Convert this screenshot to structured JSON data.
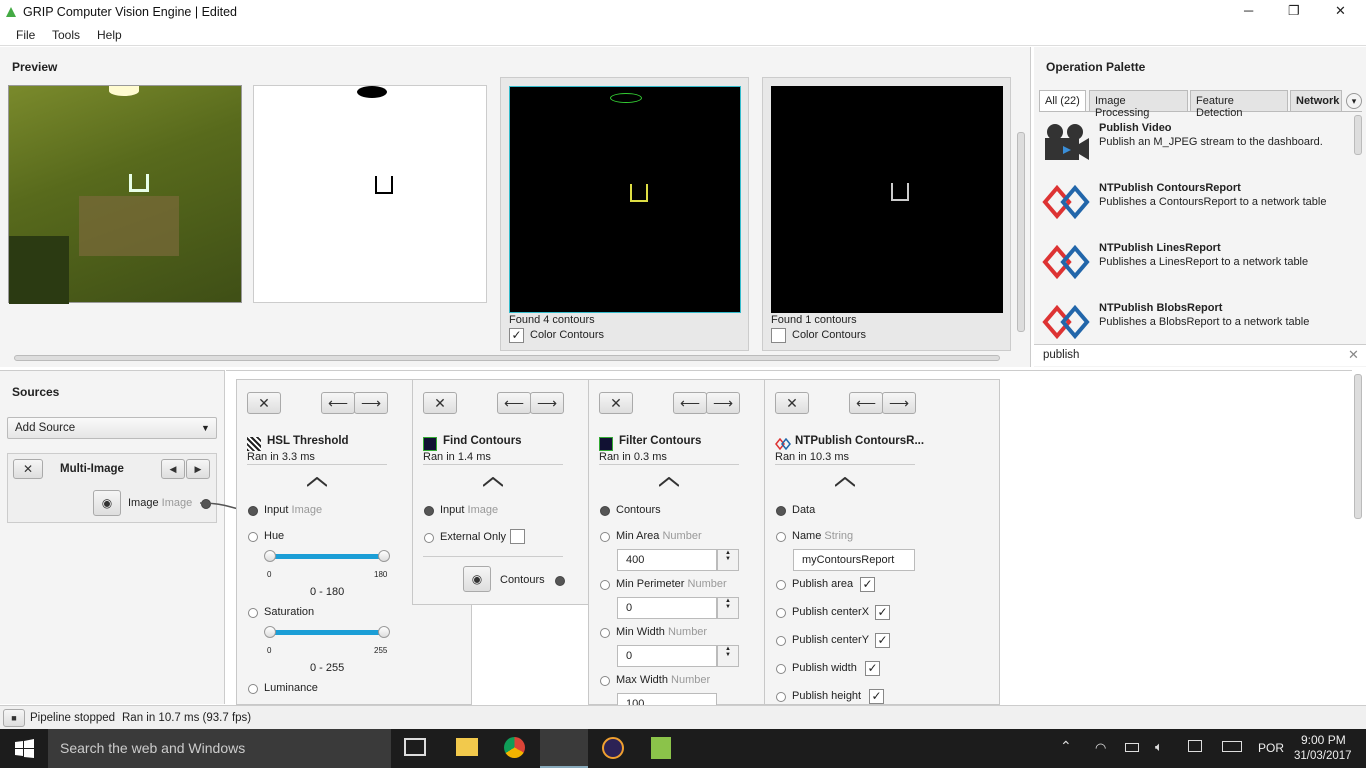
{
  "window": {
    "title": "GRIP Computer Vision Engine | Edited",
    "min": "─",
    "max": "❐",
    "close": "✕"
  },
  "menu": [
    "File",
    "Tools",
    "Help"
  ],
  "preview": {
    "title": "Preview",
    "contours1": "Found 4 contours",
    "contours2": "Found 1 contours",
    "color_contours": "Color Contours"
  },
  "palette": {
    "title": "Operation Palette",
    "tabs": [
      "All (22)",
      "Image Processing",
      "Feature Detection",
      "Network"
    ],
    "items": [
      {
        "name": "Publish Video",
        "desc": "Publish an M_JPEG stream to the dashboard."
      },
      {
        "name": "NTPublish ContoursReport",
        "desc": "Publishes a ContoursReport to a network table"
      },
      {
        "name": "NTPublish LinesReport",
        "desc": "Publishes a LinesReport to a network table"
      },
      {
        "name": "NTPublish BlobsReport",
        "desc": "Publishes a BlobsReport to a network table"
      }
    ],
    "search": "publish"
  },
  "sources": {
    "title": "Sources",
    "add": "Add Source",
    "card": "Multi-Image",
    "out": "Image",
    "out_type": "Image"
  },
  "steps": {
    "hsl": {
      "name": "HSL Threshold",
      "time": "Ran in 3.3 ms",
      "input": "Input",
      "input_type": "Image",
      "hue": "Hue",
      "hue_min": "0",
      "hue_max": "180",
      "hue_range": "0 - 180",
      "sat": "Saturation",
      "sat_min": "0",
      "sat_max": "255",
      "sat_range": "0 - 255",
      "lum": "Luminance"
    },
    "find": {
      "name": "Find Contours",
      "time": "Ran in 1.4 ms",
      "input": "Input",
      "input_type": "Image",
      "ext": "External Only",
      "out": "Contours"
    },
    "filter": {
      "name": "Filter Contours",
      "time": "Ran in 0.3 ms",
      "contours": "Contours",
      "min_area": "Min Area",
      "min_perim": "Min Perimeter",
      "min_width": "Min Width",
      "max_width": "Max Width",
      "num": "Number",
      "v_area": "400",
      "v_perim": "0",
      "v_width": "0",
      "v_maxw": "100"
    },
    "nt": {
      "name": "NTPublish ContoursR...",
      "time": "Ran in 10.3 ms",
      "data": "Data",
      "name_lbl": "Name",
      "str": "String",
      "name_val": "myContoursReport",
      "p_area": "Publish area",
      "p_cx": "Publish centerX",
      "p_cy": "Publish centerY",
      "p_w": "Publish width",
      "p_h": "Publish height"
    }
  },
  "status": {
    "state": "Pipeline stopped",
    "ran": "Ran in 10.7 ms (93.7 fps)"
  },
  "taskbar": {
    "search": "Search the web and Windows",
    "lang": "POR",
    "time": "9:00 PM",
    "date": "31/03/2017"
  }
}
